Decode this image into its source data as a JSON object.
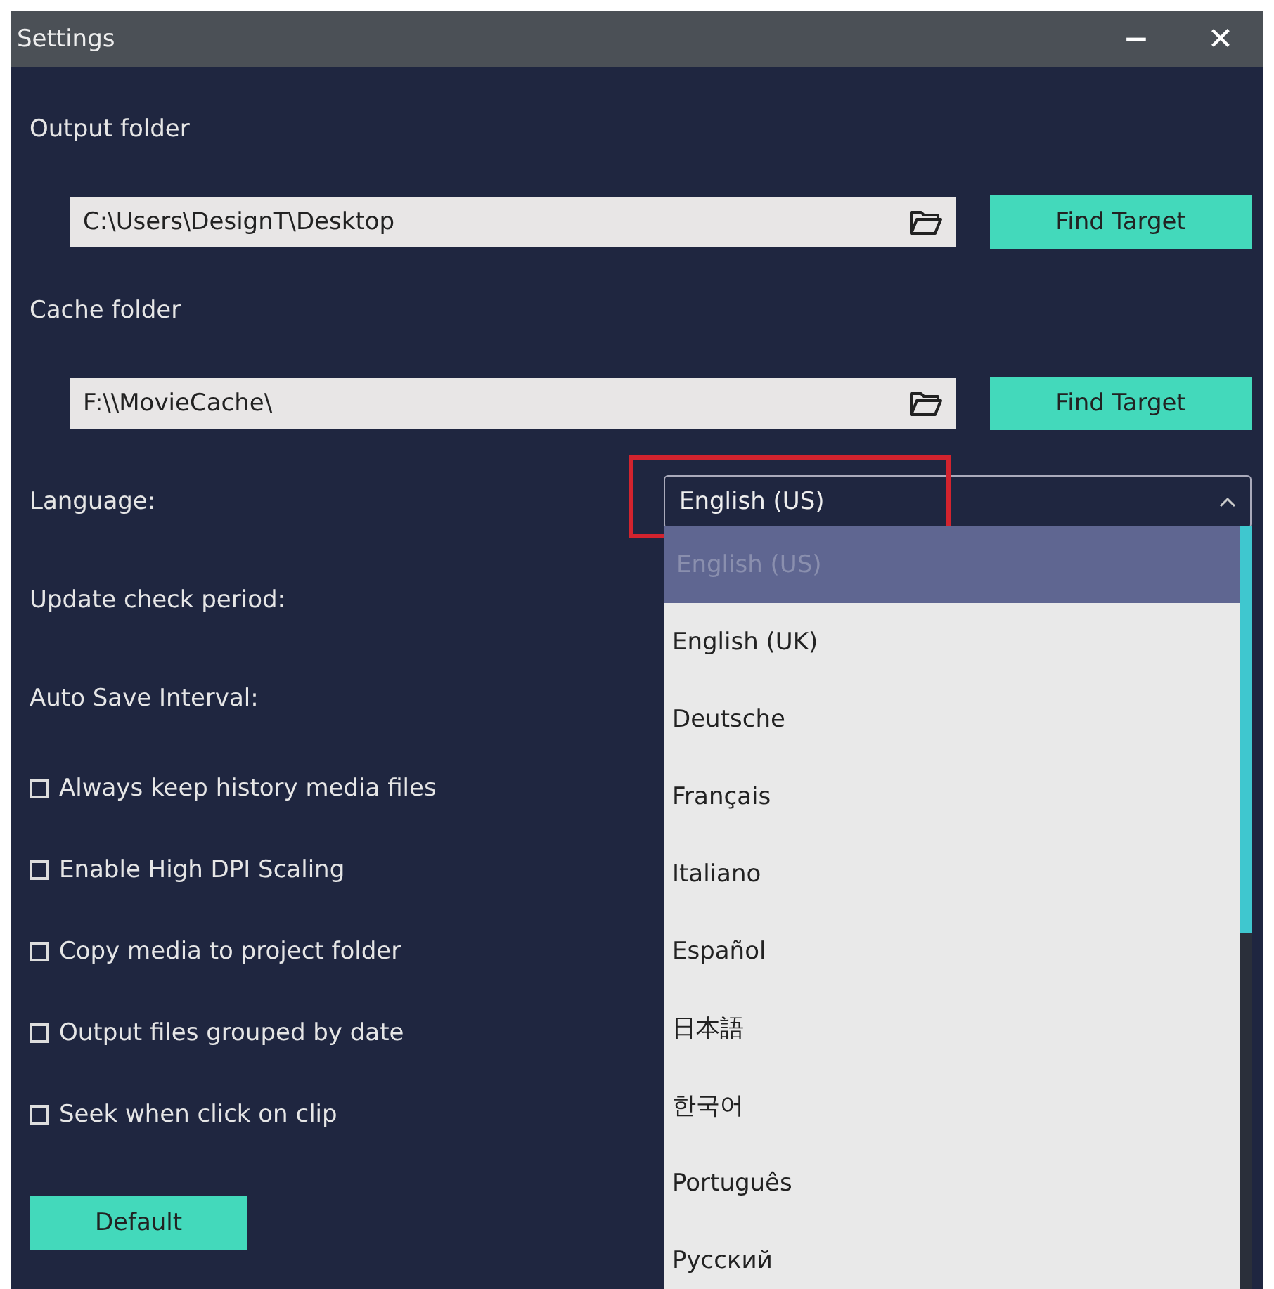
{
  "window": {
    "title": "Settings",
    "controls": [
      "−",
      "✕"
    ]
  },
  "output_folder": {
    "label": "Output folder",
    "value": "C:\\Users\\DesignT\\Desktop",
    "button": "Find Target"
  },
  "cache_folder": {
    "label": "Cache folder",
    "value": "F:\\\\MovieCache\\",
    "button": "Find Target"
  },
  "language": {
    "label": "Language:",
    "value": "English (US)",
    "expanded": true,
    "highlighted": true,
    "options": [
      {
        "label": "English (US)",
        "selected": true
      },
      {
        "label": "English (UK)",
        "selected": false
      },
      {
        "label": "Deutsche",
        "selected": false
      },
      {
        "label": "Français",
        "selected": false
      },
      {
        "label": "Italiano",
        "selected": false
      },
      {
        "label": "Español",
        "selected": false
      },
      {
        "label": "日本語",
        "selected": false
      },
      {
        "label": "한국어",
        "selected": false
      },
      {
        "label": "Português",
        "selected": false
      },
      {
        "label": "Русский",
        "selected": false
      }
    ]
  },
  "settings": [
    {
      "label": "Update check period:"
    },
    {
      "label": "Auto Save Interval:"
    }
  ],
  "checkboxes": [
    {
      "label": "Always keep history media files",
      "checked": false
    },
    {
      "label": "Enable High DPI Scaling",
      "checked": false
    },
    {
      "label": "Copy media to project folder",
      "checked": false
    },
    {
      "label": "Output files grouped by date",
      "checked": false
    },
    {
      "label": "Seek when click on clip",
      "checked": false
    }
  ],
  "default_button": "Default"
}
